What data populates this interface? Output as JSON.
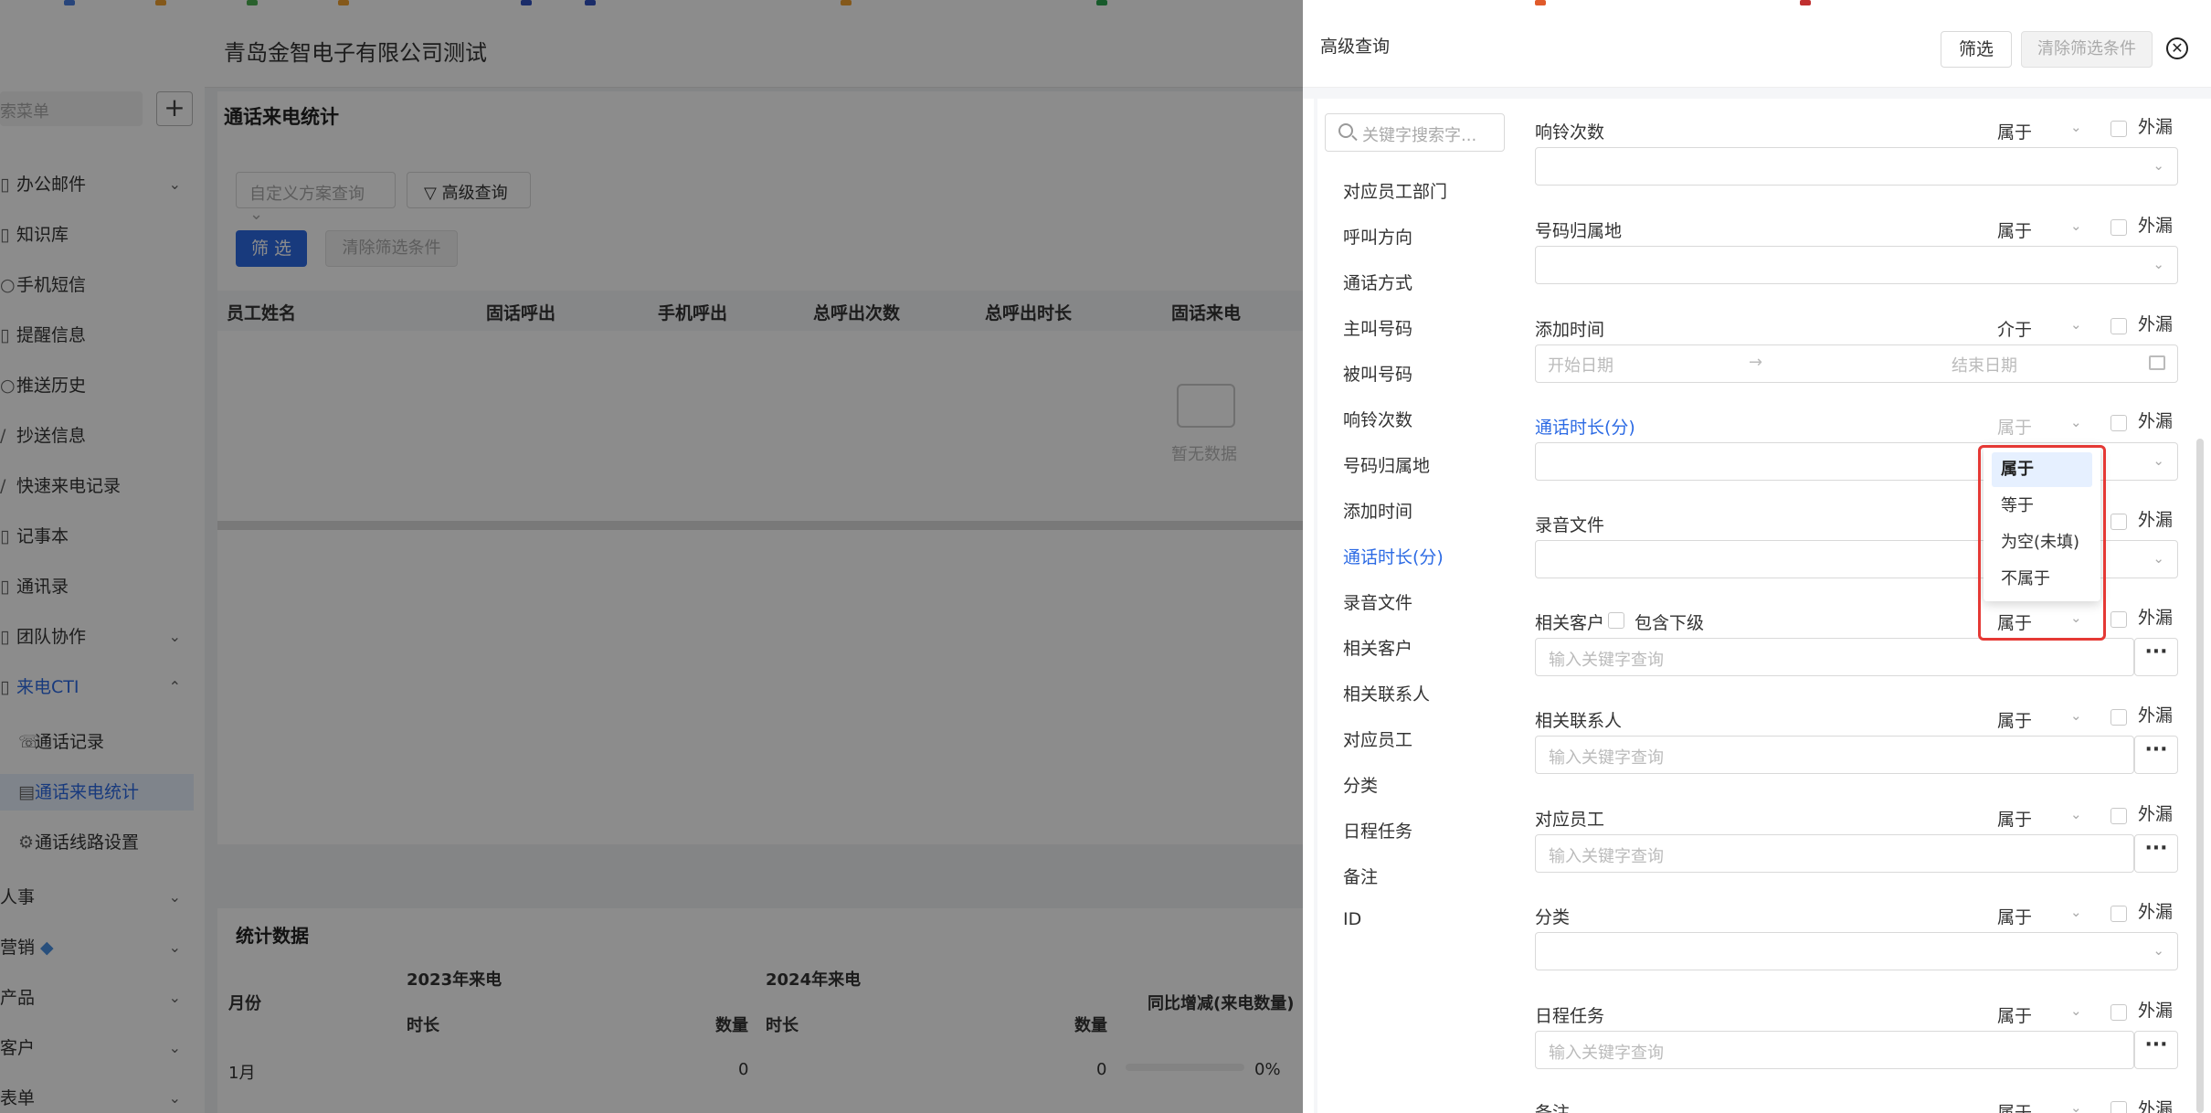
{
  "background": {
    "company": "青岛金智电子有限公司测试",
    "sidebar_search_placeholder": "索菜单",
    "sidebar_plus": "+",
    "menu": [
      {
        "label": "办公邮件",
        "icon": "mail-icon"
      },
      {
        "label": "知识库",
        "icon": "book-icon"
      },
      {
        "label": "手机短信",
        "icon": "sms-icon"
      },
      {
        "label": "提醒信息",
        "icon": "bell-icon"
      },
      {
        "label": "推送历史",
        "icon": "history-icon"
      },
      {
        "label": "抄送信息",
        "icon": "cc-icon"
      },
      {
        "label": "快速来电记录",
        "icon": "phone-icon"
      },
      {
        "label": "记事本",
        "icon": "note-icon"
      },
      {
        "label": "通讯录",
        "icon": "contacts-icon"
      },
      {
        "label": "团队协作",
        "icon": "team-icon"
      },
      {
        "label": "来电CTI",
        "icon": "cti-icon"
      },
      {
        "label": "通话记录",
        "icon": "call-log-icon"
      },
      {
        "label": "通话来电统计",
        "icon": "stats-icon"
      },
      {
        "label": "通话线路设置",
        "icon": "settings-icon"
      },
      {
        "label": "人事"
      },
      {
        "label": "营销"
      },
      {
        "label": "产品"
      },
      {
        "label": "客户"
      },
      {
        "label": "表单"
      }
    ],
    "page_title": "通话来电统计",
    "plan_select_placeholder": "自定义方案查询",
    "advanced_query": "高级查询",
    "filter_btn": "筛 选",
    "clear_btn": "清除筛选条件",
    "table_headers": [
      "员工姓名",
      "固话呼出",
      "手机呼出",
      "总呼出次数",
      "总呼出时长",
      "固话来电"
    ],
    "empty_text": "暂无数据",
    "stats_title": "统计数据",
    "stats_headers": {
      "month": "月份",
      "y2023": "2023年来电",
      "y2024": "2024年来电",
      "yoy": "同比增减(来电数量)",
      "duration": "时长",
      "count": "数量"
    },
    "stats_row": {
      "month": "1月",
      "c2023": "0",
      "c2024": "0",
      "yoy": "0%"
    }
  },
  "drawer": {
    "title": "高级查询",
    "filter_btn": "筛选",
    "clear_btn": "清除筛选条件",
    "close": "✕",
    "search_placeholder": "关键字搜索字...",
    "nav": [
      "对应员工部门",
      "呼叫方向",
      "通话方式",
      "主叫号码",
      "被叫号码",
      "响铃次数",
      "号码归属地",
      "添加时间",
      "通话时长(分)",
      "录音文件",
      "相关客户",
      "相关联系人",
      "对应员工",
      "分类",
      "日程任务",
      "备注",
      "ID"
    ],
    "fields": [
      {
        "label": "响铃次数",
        "op": "属于",
        "kind": "select"
      },
      {
        "label": "号码归属地",
        "op": "属于",
        "kind": "select"
      },
      {
        "label": "添加时间",
        "op": "介于",
        "kind": "date",
        "start": "开始日期",
        "arrow": "→",
        "end": "结束日期"
      },
      {
        "label": "通话时长(分)",
        "op": "属于",
        "kind": "select"
      },
      {
        "label": "录音文件",
        "op": "属于",
        "kind": "select"
      },
      {
        "label": "相关客户",
        "op": "属于",
        "kind": "lookup",
        "placeholder": "输入关键字查询",
        "include_sub": "包含下级"
      },
      {
        "label": "相关联系人",
        "op": "属于",
        "kind": "lookup",
        "placeholder": "输入关键字查询"
      },
      {
        "label": "对应员工",
        "op": "属于",
        "kind": "lookup",
        "placeholder": "输入关键字查询"
      },
      {
        "label": "分类",
        "op": "属于",
        "kind": "select"
      },
      {
        "label": "日程任务",
        "op": "属于",
        "kind": "lookup",
        "placeholder": "输入关键字查询"
      },
      {
        "label": "备注",
        "op": "属于"
      }
    ],
    "exclude_label": "外漏",
    "more": "···",
    "dropdown_options": [
      "属于",
      "等于",
      "为空(未填)",
      "不属于"
    ],
    "dropdown_selected": "属于"
  }
}
